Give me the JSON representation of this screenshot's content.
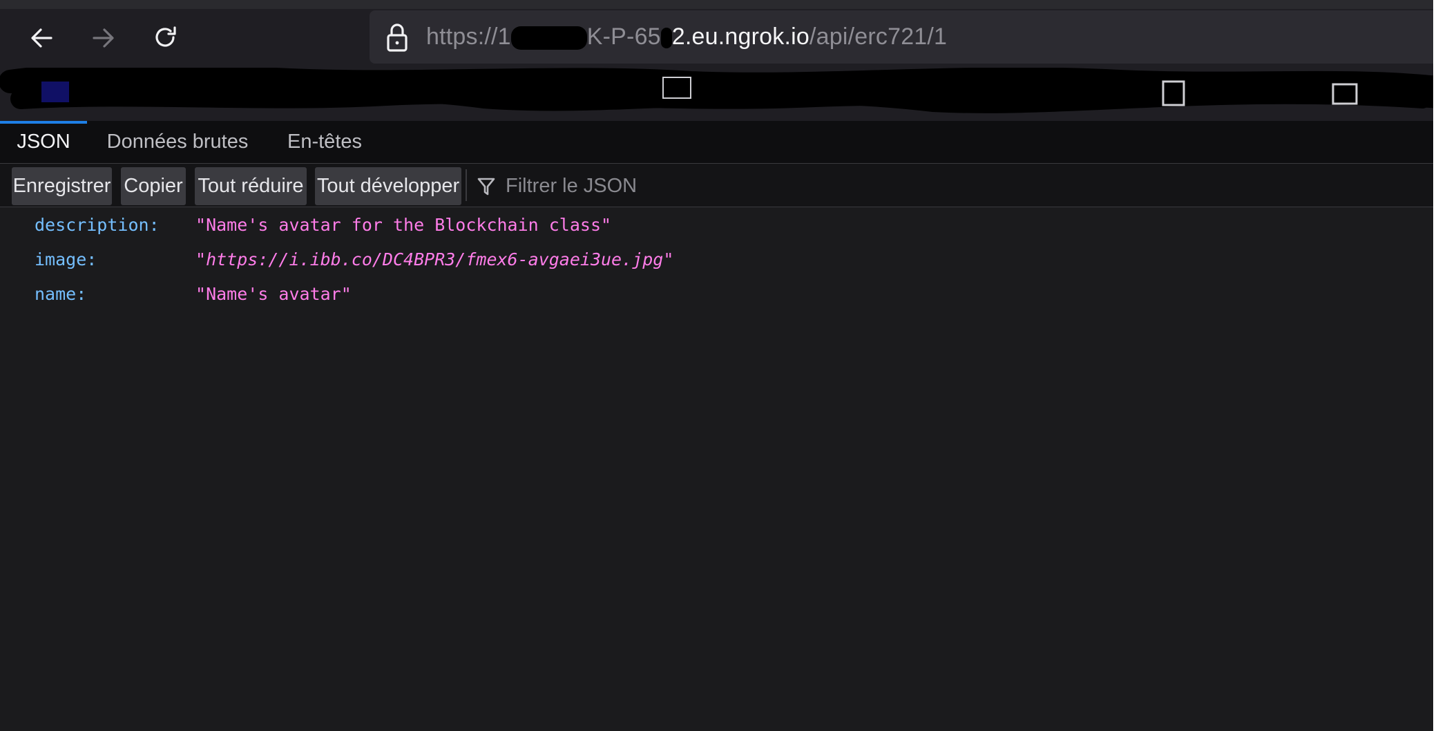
{
  "browser": {
    "url": {
      "scheme_and_redacted": "https://",
      "partial_host_prefix": "1",
      "partial_host_mid": "K-P-65",
      "partial_host_end": "2",
      "host": ".eu.ngrok.io",
      "path": "/api/erc721/1"
    },
    "icons": {
      "back": "back-arrow-icon",
      "forward": "forward-arrow-icon",
      "reload": "reload-icon",
      "lock": "lock-icon"
    }
  },
  "viewer": {
    "tabs": [
      {
        "label": "JSON",
        "active": true
      },
      {
        "label": "Données brutes",
        "active": false
      },
      {
        "label": "En-têtes",
        "active": false
      }
    ],
    "toolbar": {
      "save_label": "Enregistrer",
      "copy_label": "Copier",
      "collapse_label": "Tout réduire",
      "expand_label": "Tout développer",
      "filter_placeholder": "Filtrer le JSON"
    }
  },
  "json": {
    "rows": [
      {
        "key": "description:",
        "value": "Name's avatar for the Blockchain class"
      },
      {
        "key": "image:",
        "value": "https://i.ibb.co/DC4BPR3/fmex6-avgaei3ue.jpg"
      },
      {
        "key": "name:",
        "value": "Name's avatar"
      }
    ]
  },
  "colors": {
    "accent": "#1e7fe6",
    "json_key": "#75bfff",
    "json_string": "#ff7de9",
    "background": "#1b1b1d"
  }
}
